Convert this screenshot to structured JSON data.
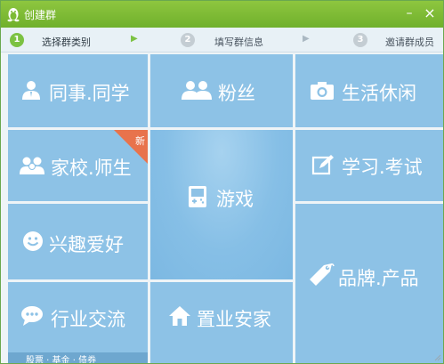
{
  "window": {
    "title": "创建群",
    "title_icon": "qq-penguin-icon",
    "minimize_glyph": "–",
    "close_glyph": "×"
  },
  "steps": [
    {
      "number": "1",
      "label": "选择群类别",
      "active": true
    },
    {
      "number": "2",
      "label": "填写群信息",
      "active": false
    },
    {
      "number": "3",
      "label": "邀请群成员",
      "active": false
    }
  ],
  "step_arrow": "▶",
  "categories": {
    "colleague": {
      "label": "同事.同学",
      "icon": "people-icon"
    },
    "fans": {
      "label": "粉丝",
      "icon": "group-icon"
    },
    "life": {
      "label": "生活休闲",
      "icon": "camera-icon"
    },
    "school": {
      "label": "家校.师生",
      "icon": "family-icon",
      "badge": "新"
    },
    "game": {
      "label": "游戏",
      "icon": "gamepad-icon"
    },
    "study": {
      "label": "学习.考试",
      "icon": "pencil-icon"
    },
    "hobby": {
      "label": "兴趣爱好",
      "icon": "smiley-icon"
    },
    "brand": {
      "label": "品牌.产品",
      "icon": "tag-icon"
    },
    "industry": {
      "label": "行业交流",
      "icon": "chat-icon"
    },
    "estate": {
      "label": "置业安家",
      "icon": "house-icon"
    }
  },
  "bottom_strip_text": "股票 · 基金 · 债券",
  "colors": {
    "title_bar": "#7dbb35",
    "tile": "#8dc2e6",
    "tile_center": "#7eb9e3",
    "active_step": "#7cc242",
    "inactive_step": "#c4cdd3",
    "badge": "#e8734c"
  }
}
